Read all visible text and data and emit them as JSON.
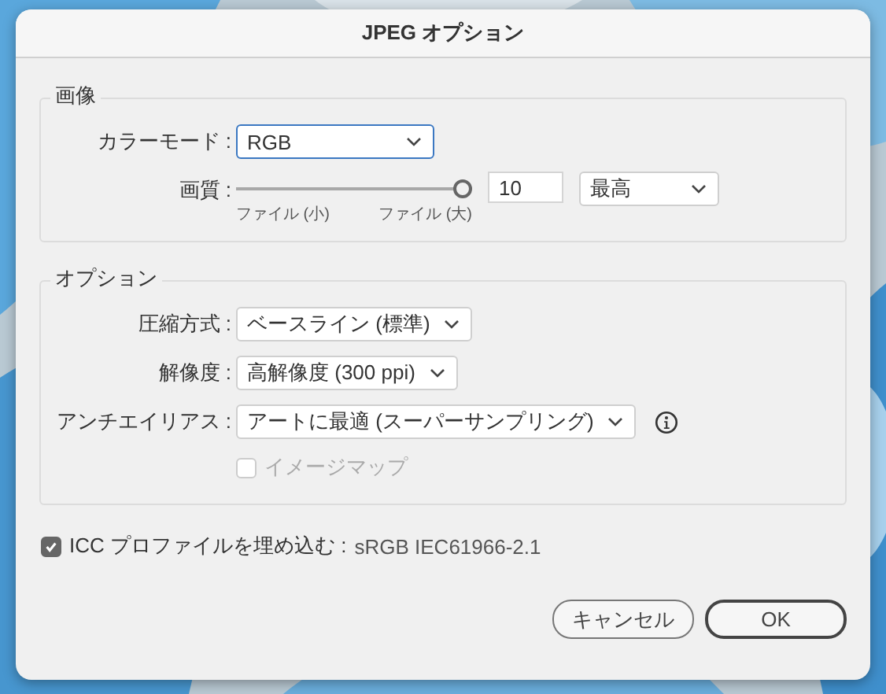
{
  "window": {
    "title": "JPEG オプション"
  },
  "image_group": {
    "legend": "画像",
    "color_mode": {
      "label": "カラーモード :",
      "value": "RGB",
      "focused": true
    },
    "quality": {
      "label": "画質 :",
      "level": 1,
      "value": "10",
      "preset": "最高",
      "min_label": "ファイル (小)",
      "max_label": "ファイル (大)"
    }
  },
  "options_group": {
    "legend": "オプション",
    "rows": [
      {
        "label": "圧縮方式 :",
        "value": "ベースライン (標準)",
        "info": false
      },
      {
        "label": "解像度 :",
        "value": "高解像度 (300 ppi)",
        "info": false
      },
      {
        "label": "アンチエイリアス :",
        "value": "アートに最適 (スーパーサンプリング)",
        "info": true
      }
    ],
    "image_map": {
      "label": "イメージマップ",
      "checked": false,
      "disabled": true
    }
  },
  "icc": {
    "label": "ICC プロファイルを埋め込む :",
    "profile": "sRGB IEC61966-2.1",
    "checked": true
  },
  "buttons": [
    {
      "label": "キャンセル",
      "default": false
    },
    {
      "label": "OK",
      "default": true
    }
  ]
}
